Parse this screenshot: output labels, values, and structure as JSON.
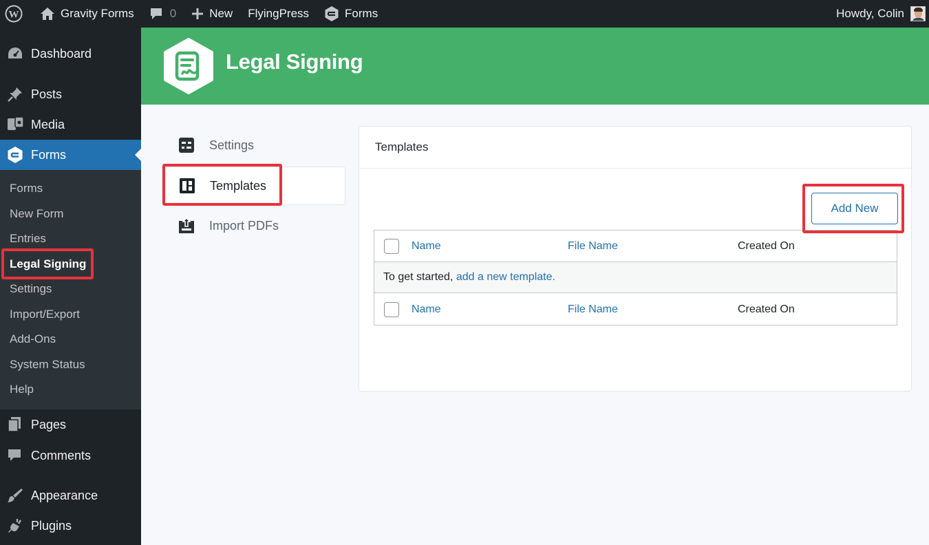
{
  "adminbar": {
    "site_name": "Gravity Forms",
    "comments_count": "0",
    "new_label": "New",
    "flyingpress_label": "FlyingPress",
    "forms_label": "Forms",
    "howdy": "Howdy, Colin"
  },
  "sidebar": {
    "dashboard": "Dashboard",
    "posts": "Posts",
    "media": "Media",
    "forms": "Forms",
    "submenu": [
      "Forms",
      "New Form",
      "Entries",
      "Legal Signing",
      "Settings",
      "Import/Export",
      "Add-Ons",
      "System Status",
      "Help"
    ],
    "pages": "Pages",
    "comments": "Comments",
    "appearance": "Appearance",
    "plugins": "Plugins"
  },
  "header": {
    "title": "Legal Signing"
  },
  "settings_nav": {
    "items": [
      {
        "label": "Settings",
        "icon": "settings-sliders-icon"
      },
      {
        "label": "Templates",
        "icon": "templates-layout-icon"
      },
      {
        "label": "Import PDFs",
        "icon": "upload-icon"
      }
    ],
    "active": "Templates"
  },
  "panel": {
    "title": "Templates",
    "add_new": "Add New",
    "columns": [
      "Name",
      "File Name",
      "Created On"
    ],
    "empty_prefix": "To get started, ",
    "empty_link": "add a new template."
  },
  "colors": {
    "header_green": "#45b06a",
    "wp_blue": "#2271b1",
    "highlight_red": "#e7323c",
    "admin_dark": "#1d2327"
  }
}
